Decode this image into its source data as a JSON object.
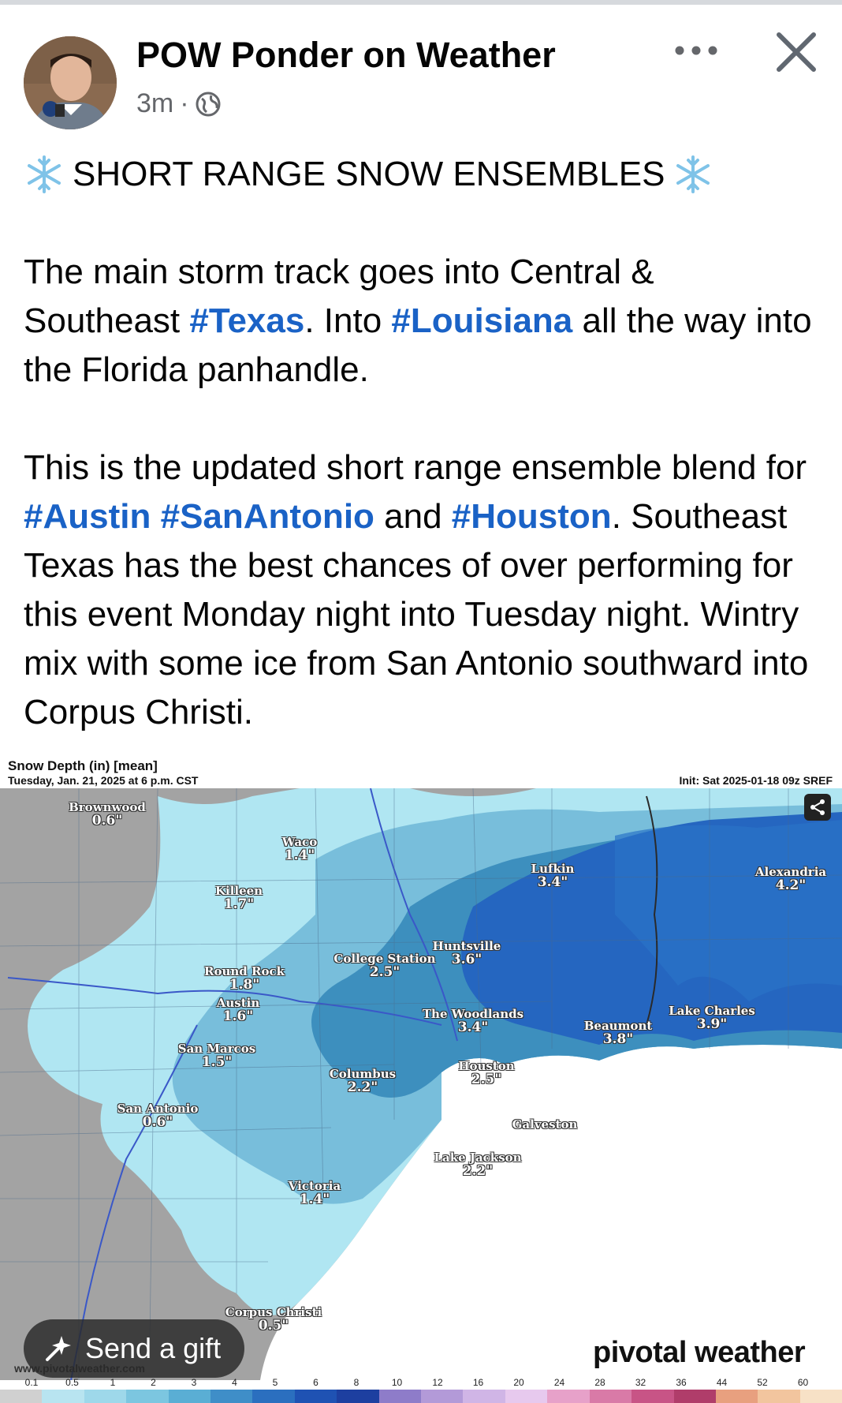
{
  "post": {
    "author": "POW Ponder on Weather",
    "time": "3m",
    "separator": "·",
    "headline": "SHORT RANGE SNOW ENSEMBLES",
    "p1_a": "The main storm track goes into Central & Southeast ",
    "p1_tag1": "#Texas",
    "p1_b": ". Into ",
    "p1_tag2": "#Louisiana",
    "p1_c": " all the way into the Florida panhandle.",
    "p2_a": "This is the updated short range ensemble blend for ",
    "p2_tag1": "#Austin",
    "p2_sp": " ",
    "p2_tag2": "#SanAntonio",
    "p2_b": " and ",
    "p2_tag3": "#Houston",
    "p2_c": ". Southeast Texas has the best chances of over performing for this event Monday night into Tuesday night. Wintry mix with some ice from San Antonio southward into Corpus Christi."
  },
  "map": {
    "title": "Snow Depth (in) [mean]",
    "subtitle": "Tuesday, Jan. 21, 2025 at 6 p.m. CST",
    "init": "Init: Sat 2025-01-18 09z SREF",
    "brand": "pivotal weather",
    "website": "www.pivotalweather.com",
    "cities": [
      {
        "name": "Brownwood",
        "value": "0.6\""
      },
      {
        "name": "Waco",
        "value": "1.4\""
      },
      {
        "name": "Killeen",
        "value": "1.7\""
      },
      {
        "name": "Lufkin",
        "value": "3.4\""
      },
      {
        "name": "Alexandria",
        "value": "4.2\""
      },
      {
        "name": "Huntsville",
        "value": "3.6\""
      },
      {
        "name": "College Station",
        "value": "2.5\""
      },
      {
        "name": "Round Rock",
        "value": "1.8\""
      },
      {
        "name": "Austin",
        "value": "1.6\""
      },
      {
        "name": "The Woodlands",
        "value": "3.4\""
      },
      {
        "name": "Beaumont",
        "value": "3.8\""
      },
      {
        "name": "Lake Charles",
        "value": "3.9\""
      },
      {
        "name": "San Marcos",
        "value": "1.5\""
      },
      {
        "name": "Columbus",
        "value": "2.2\""
      },
      {
        "name": "Houston",
        "value": "2.5\""
      },
      {
        "name": "San Antonio",
        "value": "0.6\""
      },
      {
        "name": "Galveston",
        "value": ""
      },
      {
        "name": "Lake Jackson",
        "value": "2.2\""
      },
      {
        "name": "Victoria",
        "value": "1.4\""
      },
      {
        "name": "Corpus Christi",
        "value": "0.5\""
      }
    ],
    "legend_ticks": [
      "0.1",
      "0.5",
      "1",
      "2",
      "3",
      "4",
      "5",
      "6",
      "8",
      "10",
      "12",
      "16",
      "20",
      "24",
      "28",
      "32",
      "36",
      "44",
      "52",
      "60"
    ],
    "legend_colors": [
      "#d0d0d0",
      "#b8e4f0",
      "#9ed8ea",
      "#7cc6e0",
      "#5aaed4",
      "#3f8ec8",
      "#2b6fbf",
      "#1f52b3",
      "#1d3fa0",
      "#8e7cc9",
      "#b39ad8",
      "#d0b5e6",
      "#e7c9ee",
      "#e7a1c9",
      "#d97aa7",
      "#c85486",
      "#b03d6a",
      "#e8a07f",
      "#f2c59e",
      "#f7e1c6"
    ],
    "colors": {
      "light": "#b0e6f2",
      "mid": "#78bedb",
      "dark": "#3d8fbe",
      "deep": "#2566c0",
      "gray": "#a0a0a0"
    }
  },
  "ui": {
    "gift_label": "Send a gift",
    "more_icon": "more-icon",
    "close_icon": "close-icon"
  }
}
